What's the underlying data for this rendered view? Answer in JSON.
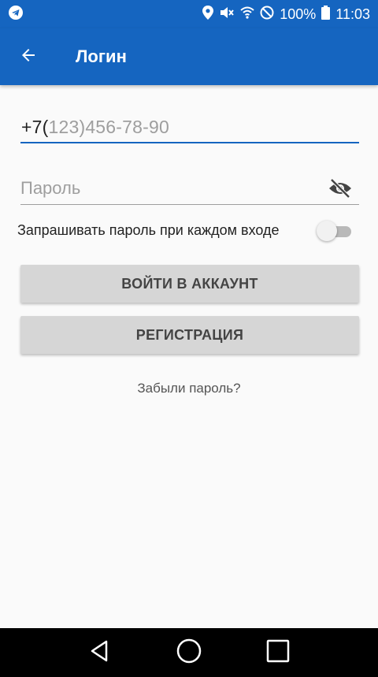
{
  "status_bar": {
    "battery": "100%",
    "time": "11:03",
    "icons": [
      "telegram-icon",
      "location-icon",
      "mute-icon",
      "wifi-icon",
      "do-not-disturb-icon",
      "battery-icon"
    ]
  },
  "app_bar": {
    "title": "Логин",
    "back_icon": "arrow-back-icon"
  },
  "form": {
    "phone": {
      "prefix": "+7(",
      "hint": "123)456-78-90"
    },
    "password": {
      "placeholder": "Пароль",
      "visibility_icon": "eye-off-icon"
    },
    "ask_password": {
      "label": "Запрашивать пароль при каждом входе",
      "enabled": false
    },
    "login_button": "ВОЙТИ В АККАУНТ",
    "register_button": "РЕГИСТРАЦИЯ",
    "forgot_link": "Забыли пароль?"
  },
  "nav_bar": {
    "icons": [
      "back-triangle-icon",
      "home-circle-icon",
      "recents-square-icon"
    ]
  },
  "colors": {
    "primary": "#1565c0",
    "button_bg": "#d6d6d6",
    "background": "#fafafa"
  }
}
